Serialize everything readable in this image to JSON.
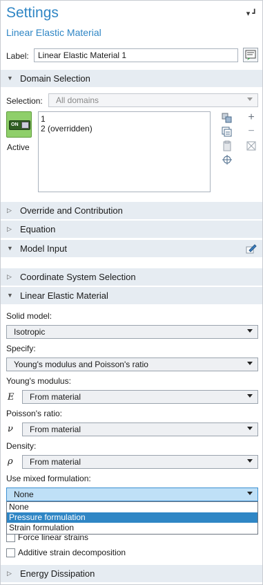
{
  "header": {
    "title": "Settings",
    "subtitle": "Linear Elastic Material",
    "pin_glyph": "▾ ┛"
  },
  "label_row": {
    "label": "Label:",
    "value": "Linear Elastic Material 1",
    "icon": "label-edit-icon"
  },
  "sections": {
    "domain_selection": "Domain Selection",
    "override": "Override and Contribution",
    "equation": "Equation",
    "model_input": "Model Input",
    "coordinate": "Coordinate System Selection",
    "linear_elastic": "Linear Elastic Material",
    "energy": "Energy Dissipation"
  },
  "selection": {
    "label": "Selection:",
    "value": "All domains",
    "items": [
      "1",
      "2 (overridden)"
    ],
    "toggle_text": "ON",
    "active_label": "Active"
  },
  "linear_elastic": {
    "solid_model_label": "Solid model:",
    "solid_model_value": "Isotropic",
    "specify_label": "Specify:",
    "specify_value": "Young's modulus and Poisson's ratio",
    "youngs_label": "Young's modulus:",
    "youngs_symbol": "E",
    "youngs_value": "From material",
    "poisson_label": "Poisson's ratio:",
    "poisson_symbol": "ν",
    "poisson_value": "From material",
    "density_label": "Density:",
    "density_symbol": "ρ",
    "density_value": "From material",
    "mixed_label": "Use mixed formulation:",
    "mixed_value": "None",
    "mixed_options": [
      "None",
      "Pressure formulation",
      "Strain formulation"
    ],
    "mixed_selected_highlight": "Pressure formulation",
    "force_linear_label": "Force linear strains",
    "additive_label": "Additive strain decomposition"
  },
  "colors": {
    "accent": "#2f86c5",
    "section_bg": "#e6ecf2",
    "active_green": "#8fcf6a"
  }
}
